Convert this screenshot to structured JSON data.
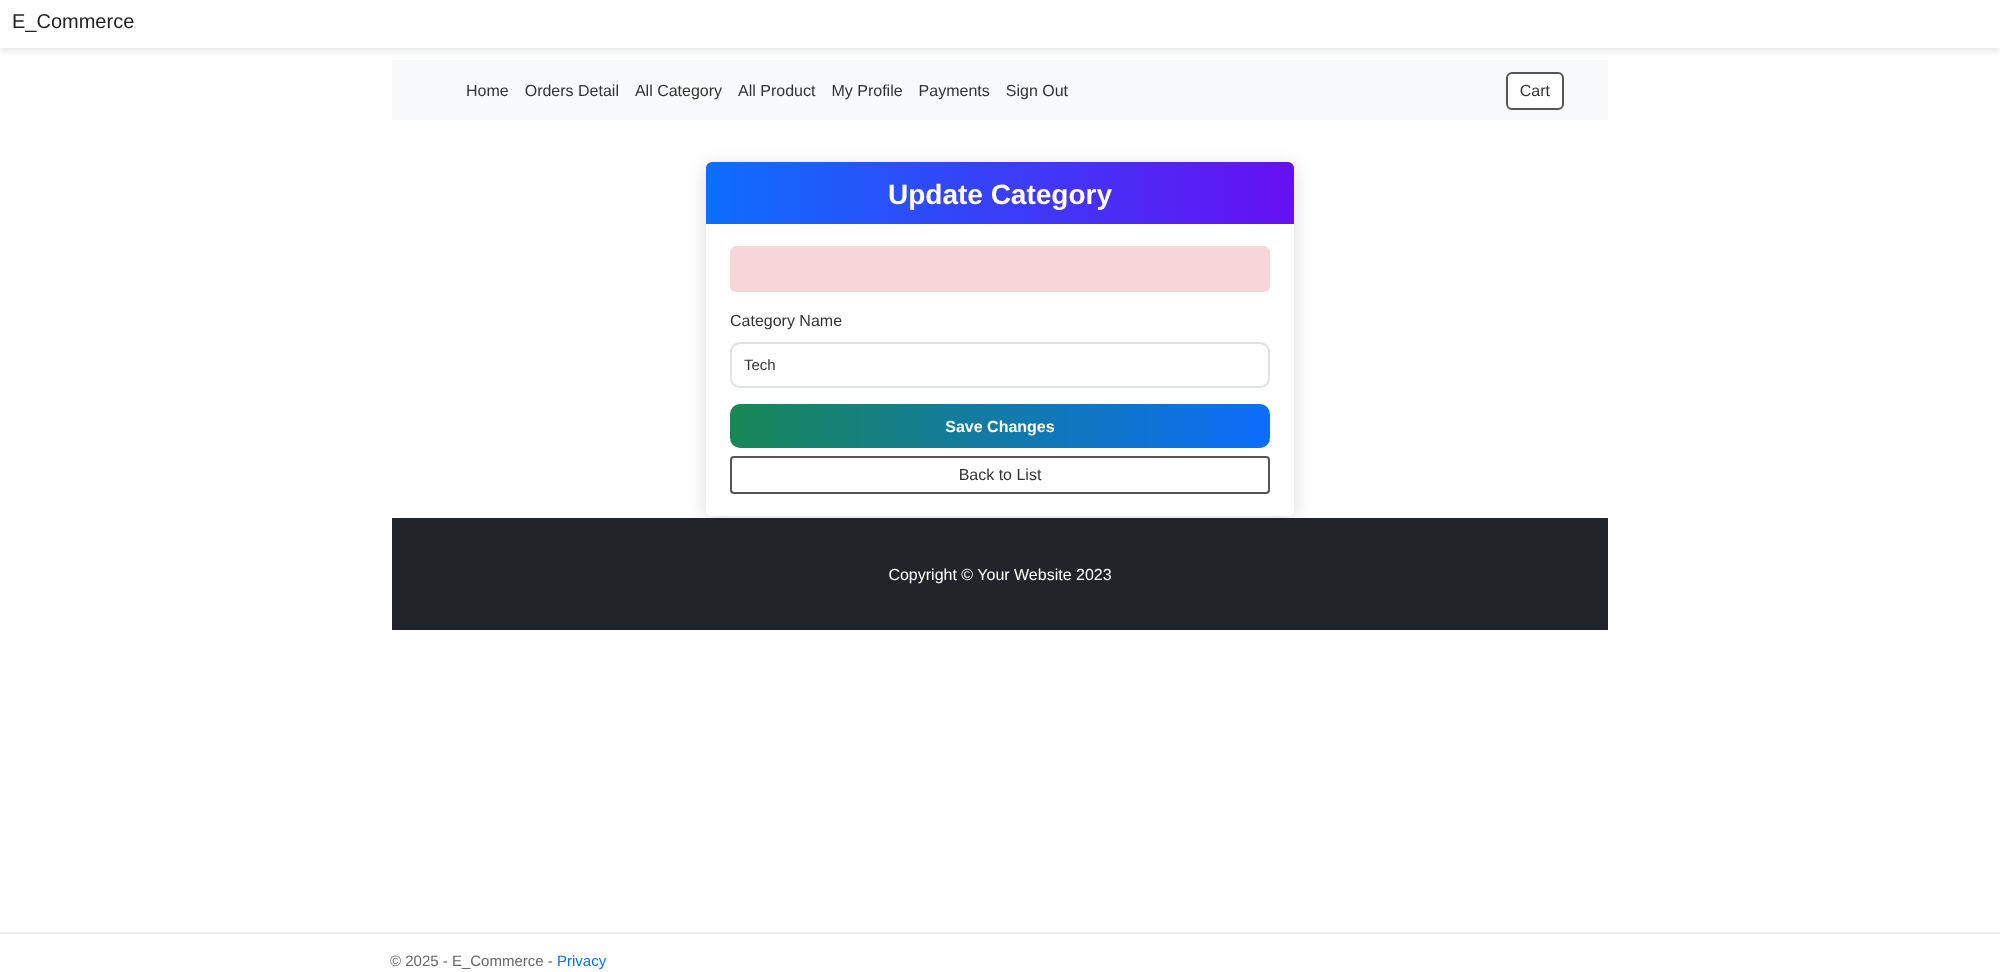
{
  "brand": "E_Commerce",
  "nav": {
    "links": [
      "Home",
      "Orders Detail",
      "All Category",
      "All Product",
      "My Profile",
      "Payments",
      "Sign Out"
    ],
    "cart": "Cart"
  },
  "card": {
    "title": "Update Category",
    "field_label": "Category Name",
    "field_value": "Tech",
    "save_button": "Save Changes",
    "back_button": "Back to List"
  },
  "footer": {
    "text": "Copyright © Your Website 2023"
  },
  "bottom": {
    "text": "© 2025 - E_Commerce -",
    "link": "Privacy"
  }
}
